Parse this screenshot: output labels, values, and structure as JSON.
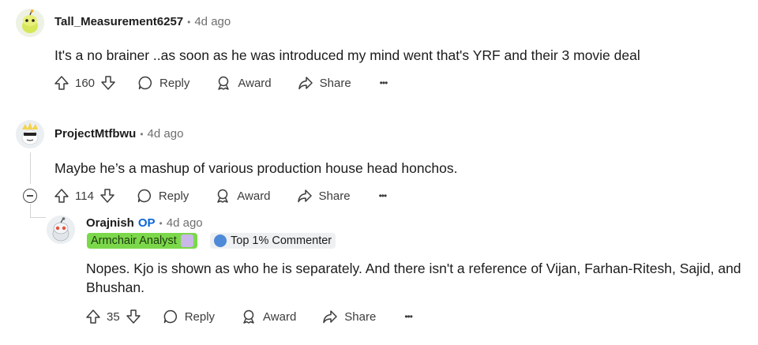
{
  "comments": [
    {
      "username": "Tall_Measurement6257",
      "time": "4d ago",
      "body": "It's a no brainer ..as soon as he was introduced my mind went that's YRF and their 3 movie deal",
      "votes": "160",
      "reply": "Reply",
      "award": "Award",
      "share": "Share",
      "more": "•••"
    },
    {
      "username": "ProjectMtfbwu",
      "time": "4d ago",
      "body": "Maybe he’s a mashup of various production house head honchos.",
      "votes": "114",
      "reply": "Reply",
      "award": "Award",
      "share": "Share",
      "more": "•••"
    },
    {
      "username": "Orajnish",
      "op_badge": "OP",
      "time": "4d ago",
      "flair": "Armchair Analyst",
      "commenter_badge": "Top 1% Commenter",
      "body": "Nopes. Kjo is shown as who he is separately. And there isn't a reference of Vijan, Farhan-Ritesh, Sajid, and Bhushan.",
      "votes": "35",
      "reply": "Reply",
      "award": "Award",
      "share": "Share",
      "more": "•••"
    }
  ],
  "separator": "•",
  "colors": {
    "op": "#0a66d8",
    "flair_bg": "#7cd84b",
    "thread_line": "#d4d4d4"
  }
}
